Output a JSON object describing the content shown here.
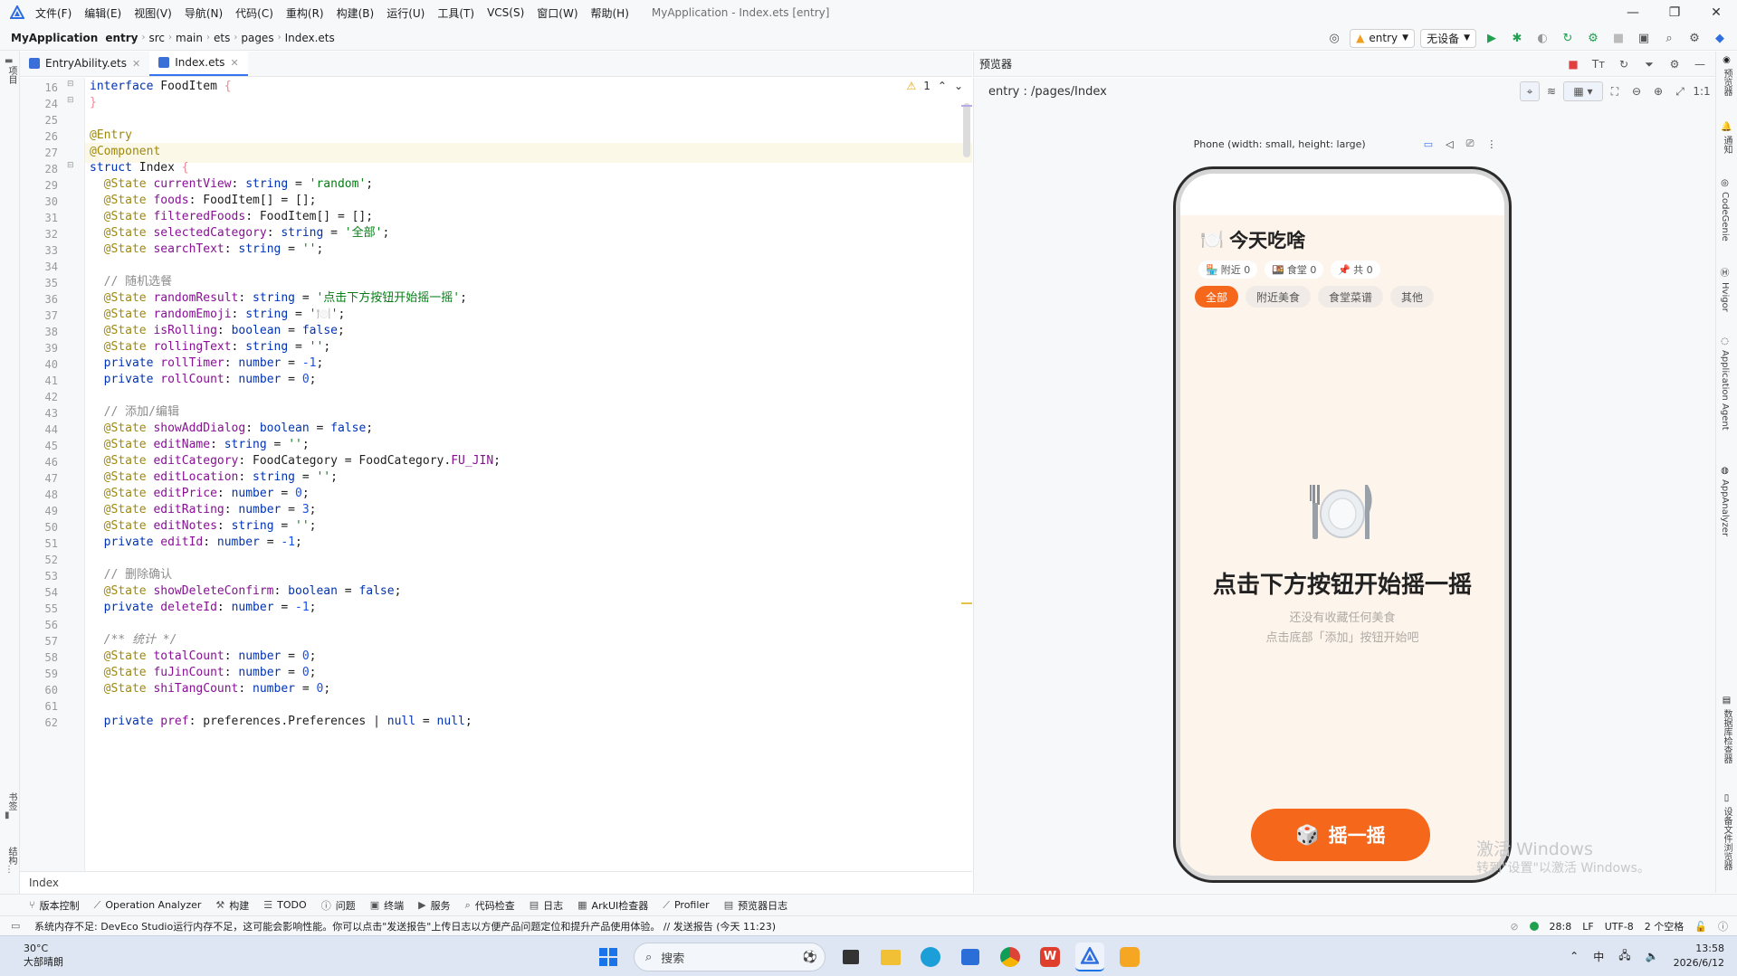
{
  "menubar": {
    "items": [
      "文件(F)",
      "编辑(E)",
      "视图(V)",
      "导航(N)",
      "代码(C)",
      "重构(R)",
      "构建(B)",
      "运行(U)",
      "工具(T)",
      "VCS(S)",
      "窗口(W)",
      "帮助(H)"
    ],
    "window_title": "MyApplication - Index.ets [entry]"
  },
  "navbar": {
    "crumbs": [
      "MyApplication",
      "entry",
      "src",
      "main",
      "ets",
      "pages",
      "Index.ets"
    ],
    "module": "entry",
    "device": "无设备"
  },
  "left_strip": {
    "top_label": "项目",
    "bottom_label1": "书签",
    "bottom_label2": "结构"
  },
  "editor": {
    "tabs": [
      {
        "label": "EntryAbility.ets",
        "active": false
      },
      {
        "label": "Index.ets",
        "active": true
      }
    ],
    "warning_count": "1",
    "breadcrumb": "Index",
    "line_numbers": [
      "16",
      "24",
      "25",
      "26",
      "27",
      "28",
      "29",
      "30",
      "31",
      "32",
      "33",
      "34",
      "35",
      "36",
      "37",
      "38",
      "39",
      "40",
      "41",
      "42",
      "43",
      "44",
      "45",
      "46",
      "47",
      "48",
      "49",
      "50",
      "51",
      "52",
      "53",
      "54",
      "55",
      "56",
      "57",
      "58",
      "59",
      "60",
      "61",
      "62"
    ],
    "current_line": "28"
  },
  "previewer": {
    "header": "预览器",
    "path": "entry : /pages/Index",
    "device_label": "Phone (width: small, height: large)",
    "app": {
      "title_emoji": "🍽️",
      "title": "今天吃啥",
      "stats": [
        {
          "icon": "🏪",
          "label": "附近 0"
        },
        {
          "icon": "🍱",
          "label": "食堂 0"
        },
        {
          "icon": "📌",
          "label": "共 0"
        }
      ],
      "categories": [
        "全部",
        "附近美食",
        "食堂菜谱",
        "其他"
      ],
      "selected_category": "全部",
      "plate_emoji": "🍽️",
      "empty_title": "点击下方按钮开始摇一摇",
      "empty_sub1": "还没有收藏任何美食",
      "empty_sub2": "点击底部「添加」按钮开始吧",
      "shake_icon": "🎲",
      "shake_label": "摇一摇"
    },
    "watermark_line1": "激活 Windows",
    "watermark_line2": "转到\"设置\"以激活 Windows。"
  },
  "right_strip": [
    "预览器",
    "通知",
    "CodeGenie",
    "Hvigor",
    "Application Agent",
    "AppAnalyzer",
    "数据库检查器",
    "设备文件浏览器"
  ],
  "toolwindows": [
    "版本控制",
    "Operation Analyzer",
    "构建",
    "TODO",
    "问题",
    "终端",
    "服务",
    "代码检查",
    "日志",
    "ArkUI检查器",
    "Profiler",
    "预览器日志"
  ],
  "statusbar": {
    "message": "系统内存不足: DevEco Studio运行内存不足，这可能会影响性能。你可以点击\"发送报告\"上传日志以方便产品问题定位和提升产品使用体验。 // 发送报告 (今天 11:23)",
    "position": "28:8",
    "line_sep": "LF",
    "encoding": "UTF-8",
    "indent": "2 个空格"
  },
  "taskbar": {
    "temperature": "30°C",
    "weather": "大部晴朗",
    "search_placeholder": "搜索",
    "ime": "中",
    "time": "13:58",
    "date": "2026/6/12"
  },
  "colors": {
    "accent": "#f5671b",
    "ide_blue": "#3574f0",
    "app_bg": "#fdf4ec"
  }
}
